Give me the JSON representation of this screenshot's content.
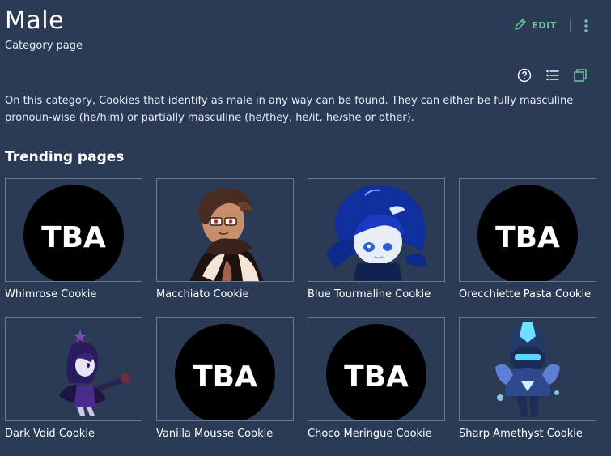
{
  "page": {
    "title": "Male",
    "subtitle": "Category page",
    "edit_label": "EDIT",
    "description": "On this category, Cookies that identify as male in any way can be found. They can either be fully masculine pronoun-wise (he/him) or partially masculine (he/they, he/it, he/she or other).",
    "section_heading": "Trending pages"
  },
  "colors": {
    "background": "#2b3a55",
    "accent": "#6ec79a",
    "card_border": "#6b7a94"
  },
  "trending": [
    {
      "label": "Whimrose Cookie",
      "image": "tba-placeholder",
      "tba_text": "TBA"
    },
    {
      "label": "Macchiato Cookie",
      "image": "macchiato-portrait"
    },
    {
      "label": "Blue Tourmaline Cookie",
      "image": "blue-tourmaline-portrait"
    },
    {
      "label": "Orecchiette Pasta Cookie",
      "image": "tba-placeholder",
      "tba_text": "TBA"
    },
    {
      "label": "Dark Void Cookie",
      "image": "dark-void-sprite"
    },
    {
      "label": "Vanilla Mousse Cookie",
      "image": "tba-placeholder",
      "tba_text": "TBA"
    },
    {
      "label": "Choco Meringue Cookie",
      "image": "tba-placeholder",
      "tba_text": "TBA"
    },
    {
      "label": "Sharp Amethyst Cookie",
      "image": "sharp-amethyst-sprite"
    }
  ]
}
